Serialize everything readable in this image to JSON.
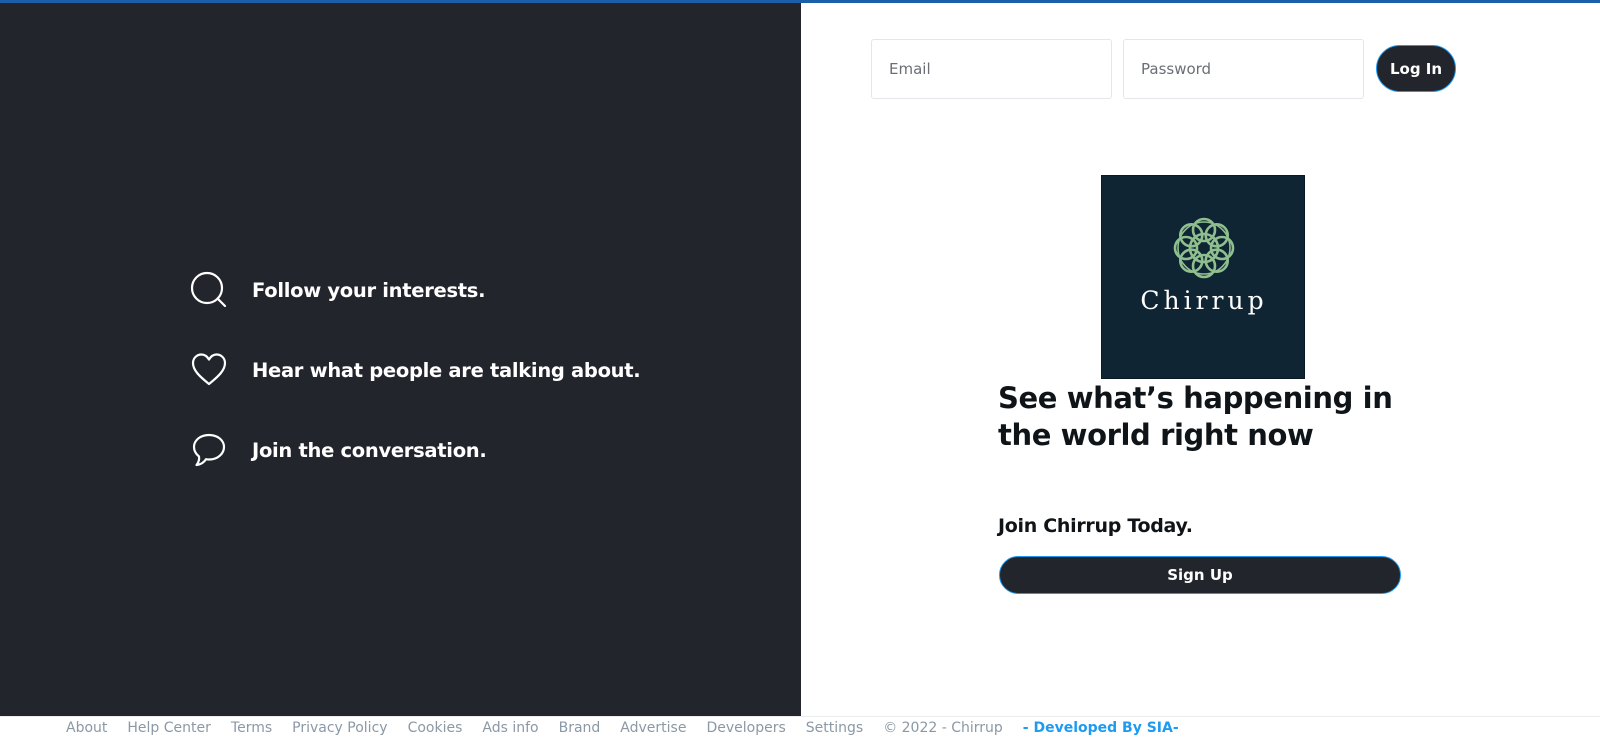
{
  "auth": {
    "email_placeholder": "Email",
    "password_placeholder": "Password",
    "login_label": "Log In"
  },
  "features": [
    {
      "icon": "search-icon",
      "label": "Follow your interests."
    },
    {
      "icon": "heart-icon",
      "label": "Hear what people are talking about."
    },
    {
      "icon": "speech-bubble-icon",
      "label": "Join the conversation."
    }
  ],
  "logo": {
    "wordmark": "Chirrup"
  },
  "headline": "See what’s happening in the world right now",
  "join_text": "Join Chirrup Today.",
  "signup_label": "Sign Up",
  "footer": {
    "links": [
      "About",
      "Help Center",
      "Terms",
      "Privacy Policy",
      "Cookies",
      "Ads info",
      "Brand",
      "Advertise",
      "Developers",
      "Settings"
    ],
    "copyright": "© 2022 - Chirrup",
    "developer": "- Developed By SIA-"
  },
  "colors": {
    "dark_panel": "#22252b",
    "accent": "#1d9bf0",
    "logo_bg": "#0f2533",
    "logo_knot": "#8fbf8f"
  }
}
